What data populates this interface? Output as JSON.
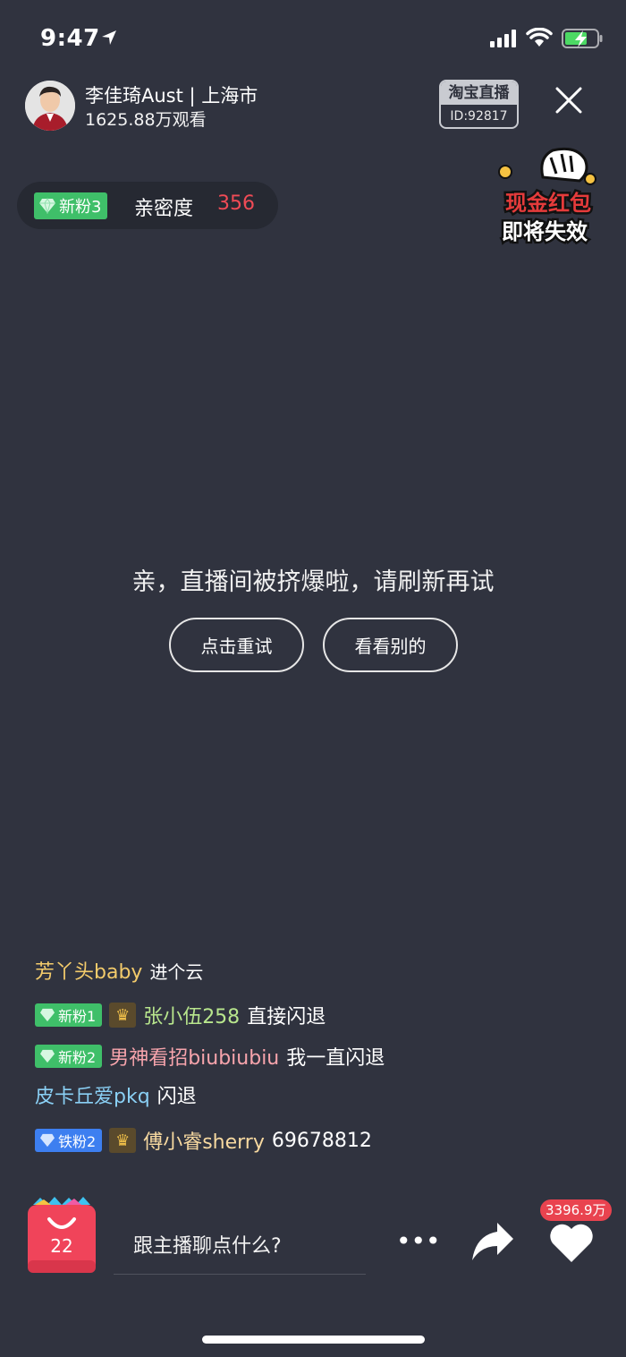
{
  "status_bar": {
    "time": "9:47"
  },
  "host": {
    "name_location": "李佳琦Aust | 上海市",
    "viewers": "1625.88万观看"
  },
  "platform_badge": {
    "name": "淘宝直播",
    "id": "ID:92817"
  },
  "intimacy": {
    "badge": "新粉3",
    "label": "亲密度",
    "value": "356"
  },
  "promo": {
    "line1": "现金红包",
    "line2": "即将失效"
  },
  "center": {
    "message": "亲，直播间被挤爆啦，请刷新再试",
    "retry_label": "点击重试",
    "other_label": "看看别的"
  },
  "chat": [
    {
      "badge": "",
      "user": "芳丫头baby",
      "text": "进个云"
    },
    {
      "badge": "新粉1",
      "crown": "♛",
      "user": "张小伍258",
      "text": "直接闪退"
    },
    {
      "badge": "新粉2",
      "user": "男神看招biubiubiu",
      "text": "我一直闪退"
    },
    {
      "badge": "",
      "user": "皮卡丘爱pkq",
      "text": "闪退"
    },
    {
      "badge": "铁粉2",
      "crown": "♛",
      "user": "傅小睿sherry",
      "text": "69678812"
    }
  ],
  "bottom": {
    "bag_count": "22",
    "input_placeholder": "跟主播聊点什么?",
    "more": "•••",
    "like_count": "3396.9万"
  },
  "colors": {
    "background": "#30333f",
    "accent_red": "#f04b56",
    "fan_green": "#3fbf69",
    "fan_blue": "#3d7ff0"
  },
  "icons": [
    "location-arrow-icon",
    "signal-icon",
    "wifi-icon",
    "battery-charging-icon",
    "close-icon",
    "gem-icon",
    "crown-icon",
    "shopping-bag-icon",
    "more-icon",
    "share-icon",
    "heart-icon"
  ]
}
